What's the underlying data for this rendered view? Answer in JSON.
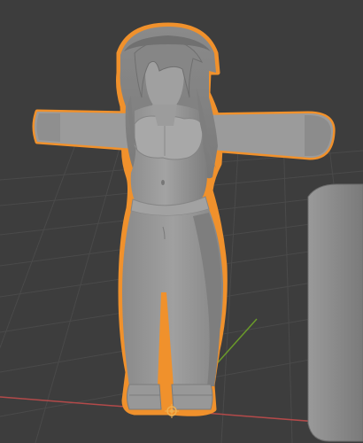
{
  "viewport": {
    "mode": "3D Viewport",
    "background_color": "#3d3d3d",
    "grid_color": "#4a4a4a",
    "x_axis_color": "#b34a4a",
    "y_axis_color": "#6a9a2a",
    "selection_outline_color": "#f0912c",
    "mesh_color": "#9d9d9d"
  },
  "scene": {
    "objects": [
      {
        "name": "character-mesh",
        "selected": true,
        "icon": "humanoid-figure"
      },
      {
        "name": "board-mesh",
        "selected": false,
        "icon": "rounded-panel"
      }
    ],
    "origin_marker": {
      "icon": "object-origin-dot"
    }
  }
}
